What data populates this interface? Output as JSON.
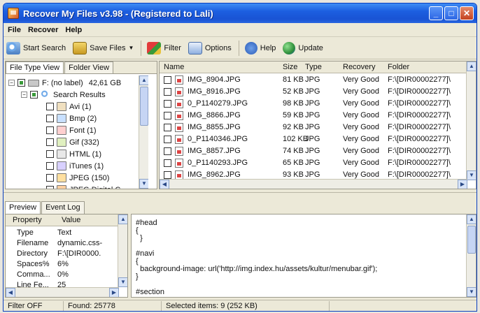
{
  "window": {
    "title": "Recover My Files v3.98  -  (Registered to Lali)"
  },
  "menu": [
    "File",
    "Recover",
    "Help"
  ],
  "toolbar": {
    "start_search": "Start Search",
    "save_files": "Save Files",
    "filter": "Filter",
    "options": "Options",
    "help": "Help",
    "update": "Update"
  },
  "left_tabs": [
    "File Type View",
    "Folder View"
  ],
  "tree": {
    "drive": {
      "label": "F: (no label)",
      "size": "42,61 GB"
    },
    "search_results": "Search Results",
    "types": [
      "Avi (1)",
      "Bmp (2)",
      "Font (1)",
      "Gif (332)",
      "HTML (1)",
      "iTunes (1)",
      "JPEG (150)",
      "JPEG Digital C"
    ]
  },
  "file_list": {
    "columns": [
      "Name",
      "Size",
      "Type",
      "Recovery",
      "Folder"
    ],
    "rows": [
      [
        "IMG_8904.JPG",
        "81 KB",
        "JPG",
        "Very Good",
        "F:\\[DIR00002277]\\"
      ],
      [
        "IMG_8916.JPG",
        "52 KB",
        "JPG",
        "Very Good",
        "F:\\[DIR00002277]\\"
      ],
      [
        "0_P1140279.JPG",
        "98 KB",
        "JPG",
        "Very Good",
        "F:\\[DIR00002277]\\"
      ],
      [
        "IMG_8866.JPG",
        "59 KB",
        "JPG",
        "Very Good",
        "F:\\[DIR00002277]\\"
      ],
      [
        "IMG_8855.JPG",
        "92 KB",
        "JPG",
        "Very Good",
        "F:\\[DIR00002277]\\"
      ],
      [
        "0_P1140346.JPG",
        "102 KB",
        "JPG",
        "Very Good",
        "F:\\[DIR00002277]\\"
      ],
      [
        "IMG_8857.JPG",
        "74 KB",
        "JPG",
        "Very Good",
        "F:\\[DIR00002277]\\"
      ],
      [
        "0_P1140293.JPG",
        "65 KB",
        "JPG",
        "Very Good",
        "F:\\[DIR00002277]\\"
      ],
      [
        "IMG_8962.JPG",
        "93 KB",
        "JPG",
        "Very Good",
        "F:\\[DIR00002277]\\"
      ]
    ]
  },
  "bottom_tabs": [
    "Preview",
    "Event Log"
  ],
  "properties": {
    "columns": [
      "Property",
      "Value"
    ],
    "rows": [
      [
        "Type",
        "Text"
      ],
      [
        "Filename",
        "dynamic.css-"
      ],
      [
        "Directory",
        "F:\\[DIR0000."
      ],
      [
        "Spaces%",
        "6%"
      ],
      [
        "Comma...",
        "0%"
      ],
      [
        "Line Fe...",
        "25"
      ]
    ]
  },
  "preview_lines": [
    "#head",
    "{",
    "  }",
    "",
    "#navi",
    "{",
    "  background-image: url('http://img.index.hu/assets/kultur/menubar.gif');",
    "}",
    "",
    "#section"
  ],
  "status": {
    "filter": "Filter OFF",
    "found": "Found: 25778",
    "selected": "Selected items: 9 (252 KB)"
  }
}
